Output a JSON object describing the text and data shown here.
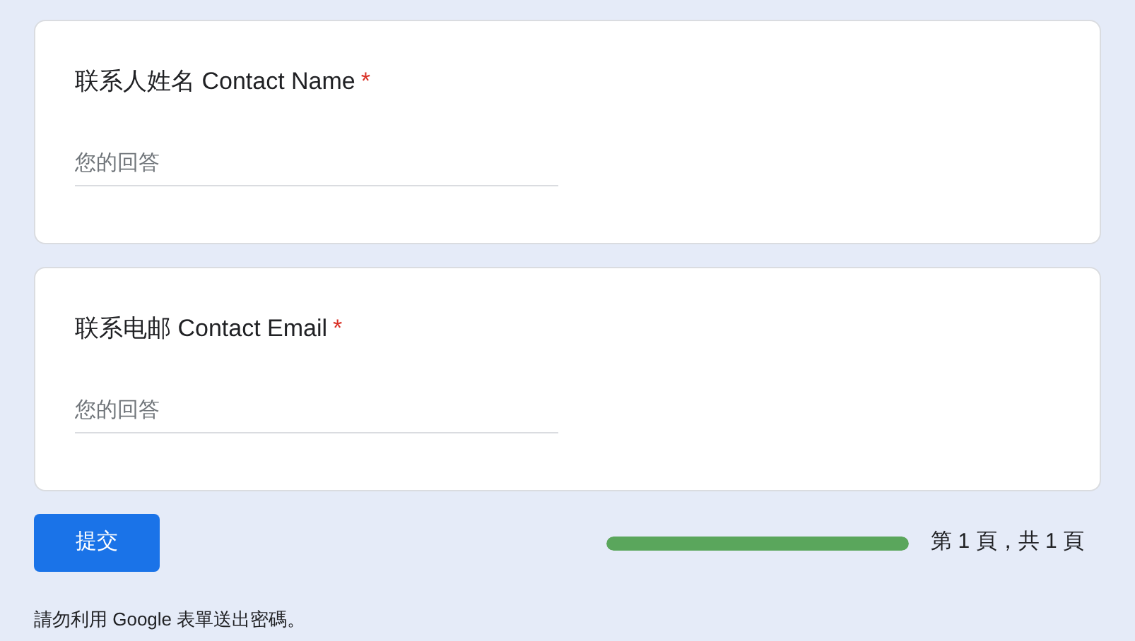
{
  "questions": [
    {
      "label": "联系人姓名 Contact Name",
      "required_mark": "*",
      "placeholder": "您的回答"
    },
    {
      "label": "联系电邮 Contact Email",
      "required_mark": "*",
      "placeholder": "您的回答"
    }
  ],
  "submit_button": "提交",
  "progress": {
    "level": 1,
    "text": "第 1 頁，共 1 頁"
  },
  "footer_note": "請勿利用 Google 表單送出密碼。"
}
